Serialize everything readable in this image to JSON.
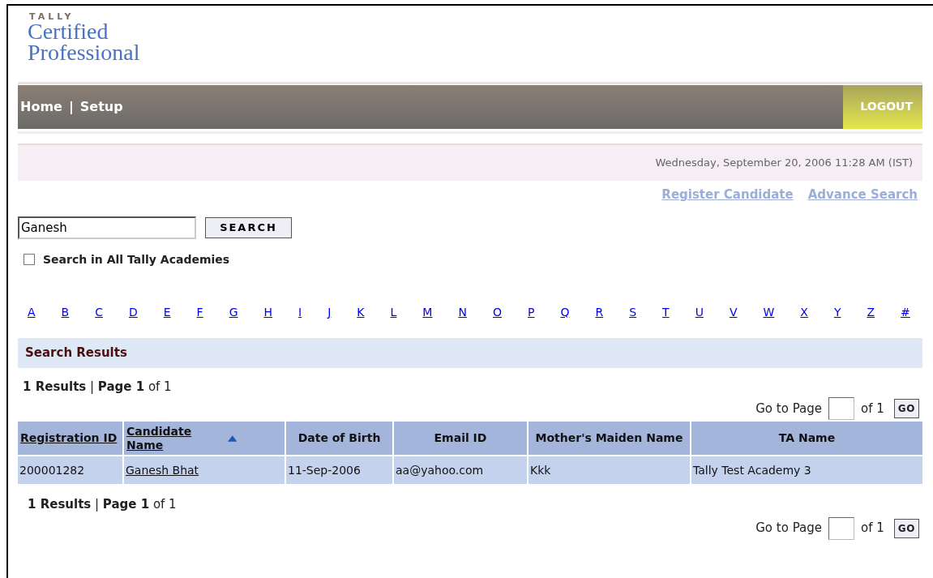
{
  "logo": {
    "brand": "TALLY",
    "line_1": "Certified",
    "line_2": "Professional"
  },
  "nav": {
    "items": [
      "Home",
      "Setup"
    ],
    "separator": "|",
    "logout": "LOGOUT"
  },
  "datetime": "Wednesday, September 20, 2006 11:28 AM (IST)",
  "links": [
    "Register Candidate",
    "Advance Search"
  ],
  "search": {
    "value": "Ganesh",
    "button": "SEARCH",
    "checkbox_label": "Search in All Tally Academies",
    "checked": false
  },
  "alphabet": [
    "A",
    "B",
    "C",
    "D",
    "E",
    "F",
    "G",
    "H",
    "I",
    "J",
    "K",
    "L",
    "M",
    "N",
    "O",
    "P",
    "Q",
    "R",
    "S",
    "T",
    "U",
    "V",
    "W",
    "X",
    "Y",
    "Z",
    "#"
  ],
  "results_title": "Search Results",
  "summary_top": "**1 Results** | **Page 1** of 1",
  "pager_top": {
    "label": "Go to Page",
    "of": "of 1",
    "button": "GO"
  },
  "table": {
    "columns": [
      {
        "label": "Registration ID",
        "kind": "link",
        "sorted": false
      },
      {
        "label": "Candidate Name",
        "kind": "link",
        "sorted": true
      },
      {
        "label": "Date of Birth",
        "kind": "plain",
        "sorted": false
      },
      {
        "label": "Email ID",
        "kind": "plain",
        "sorted": false
      },
      {
        "label": "Mother's Maiden Name",
        "kind": "plain",
        "sorted": false
      },
      {
        "label": "TA Name",
        "kind": "plain",
        "sorted": false
      }
    ],
    "rows": [
      [
        {
          "text": "200001282",
          "kind": "plain"
        },
        {
          "text": "Ganesh Bhat",
          "kind": "link"
        },
        {
          "text": "11-Sep-2006",
          "kind": "plain"
        },
        {
          "text": "aa@yahoo.com",
          "kind": "plain"
        },
        {
          "text": "Kkk",
          "kind": "plain"
        },
        {
          "text": "Tally Test Academy 3",
          "kind": "plain"
        }
      ]
    ]
  },
  "summary_bottom": "**1 Results** | **Page 1** of 1",
  "pager_bottom": {
    "label": "Go to Page",
    "of": "of 1",
    "button": "GO"
  }
}
